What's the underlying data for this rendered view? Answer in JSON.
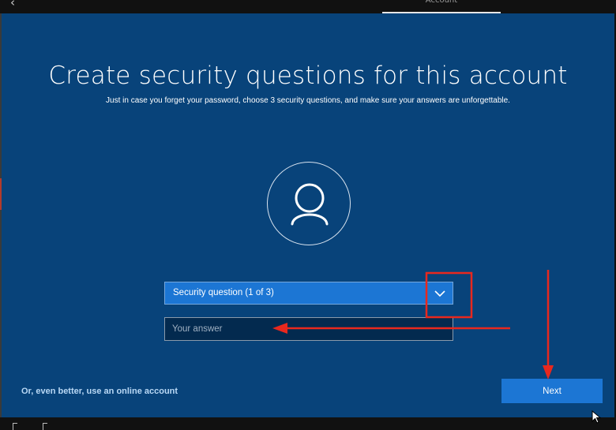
{
  "header": {
    "back_glyph": "‹",
    "section_label": "Account"
  },
  "main": {
    "title": "Create security questions for this account",
    "subtitle": "Just in case you forget your password, choose 3 security questions, and make sure your answers are unforgettable.",
    "avatar_icon": "user-icon"
  },
  "form": {
    "question_dropdown": {
      "selected": "Security question (1 of 3)"
    },
    "answer_field": {
      "value": "",
      "placeholder": "Your answer"
    }
  },
  "footer": {
    "online_account_link": "Or, even better, use an online account",
    "next_label": "Next"
  },
  "colors": {
    "panel_background": "#08437a",
    "accent_button": "#1c76d4",
    "annotation_red": "#e8281e"
  }
}
